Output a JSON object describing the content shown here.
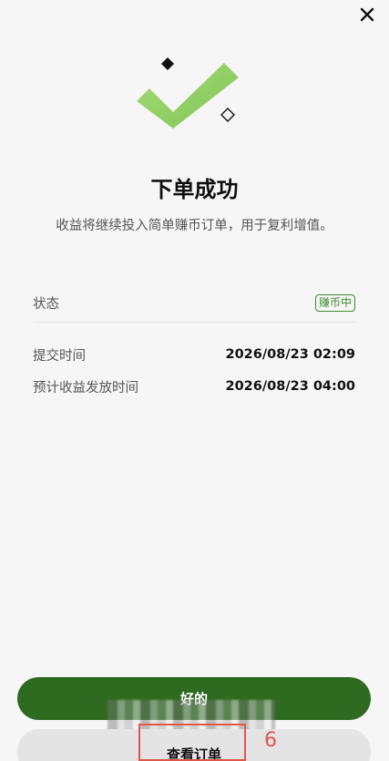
{
  "header": {
    "close_icon": "close-icon"
  },
  "hero": {
    "icon": "success-checkmark-icon",
    "accent_color": "#8fcf62"
  },
  "title": "下单成功",
  "subtitle": "收益将继续投入简单赚币订单，用于复利增值。",
  "details": {
    "status_label": "状态",
    "status_badge": "赚币中",
    "submit_time_label": "提交时间",
    "submit_time_value": "2026/08/23 02:09",
    "payout_time_label": "预计收益发放时间",
    "payout_time_value": "2026/08/23 04:00"
  },
  "buttons": {
    "primary_label": "好的",
    "secondary_label": "查看订单"
  },
  "annotation": {
    "number": "6",
    "color": "#e0574b"
  },
  "colors": {
    "primary_button": "#2e6a1f",
    "badge": "#3e8a2e"
  }
}
